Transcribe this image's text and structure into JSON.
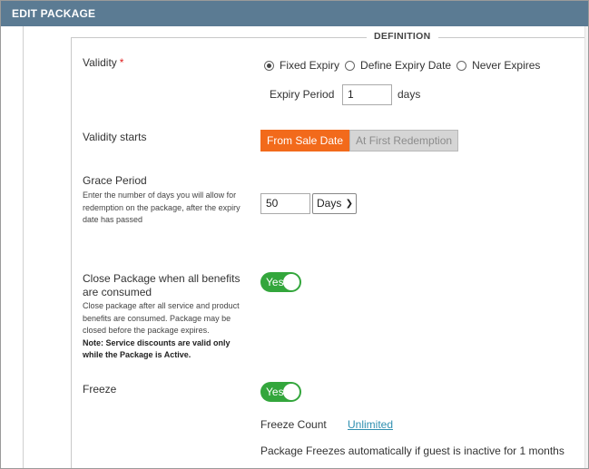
{
  "header": {
    "title": "EDIT PACKAGE"
  },
  "section": {
    "legend": "DEFINITION"
  },
  "validity": {
    "label": "Validity",
    "required_mark": "*",
    "options": [
      {
        "label": "Fixed Expiry",
        "selected": true
      },
      {
        "label": "Define Expiry Date",
        "selected": false
      },
      {
        "label": "Never Expires",
        "selected": false
      }
    ],
    "expiry_period_label": "Expiry Period",
    "expiry_period_value": "1",
    "expiry_period_unit": "days"
  },
  "validity_starts": {
    "label": "Validity starts",
    "options": [
      {
        "label": "From Sale Date",
        "active": true
      },
      {
        "label": "At First Redemption",
        "active": false
      }
    ]
  },
  "grace_period": {
    "label": "Grace Period",
    "help": "Enter the number of days you will allow for redemption on the package, after the expiry date has passed",
    "value": "50",
    "unit_selected": "Days"
  },
  "close_package": {
    "label": "Close Package when all benefits are consumed",
    "help": "Close package after all service and product benefits are consumed. Package may be closed before the package expires.",
    "note": "Note: Service discounts are valid only while the Package is Active.",
    "toggle_label": "Yes"
  },
  "freeze": {
    "label": "Freeze",
    "toggle_label": "Yes",
    "count_label": "Freeze Count",
    "count_value": "Unlimited",
    "auto_note": "Package Freezes automatically if guest is inactive for 1 months"
  },
  "colors": {
    "header_bg": "#5b7b93",
    "accent_orange": "#f26a1b",
    "toggle_green": "#33a63c",
    "link_blue": "#2f8fb0",
    "required_red": "#e01e1e"
  }
}
